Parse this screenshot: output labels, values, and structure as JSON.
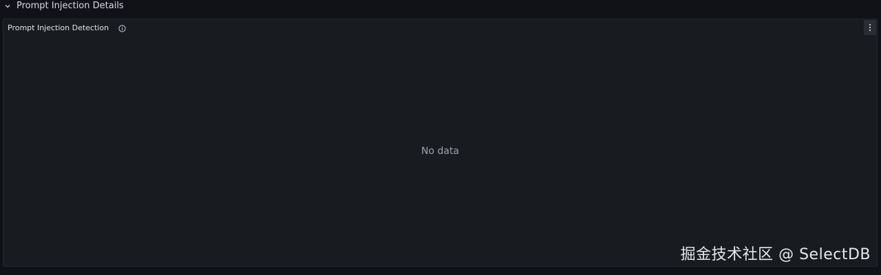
{
  "row": {
    "title": "Prompt Injection Details",
    "chevron_icon": "chevron-down-icon"
  },
  "panel": {
    "title": "Prompt Injection Detection",
    "info_icon": "info-circle-icon",
    "menu_icon": "kebab-menu-icon",
    "empty_text": "No data"
  },
  "watermark": "掘金技术社区 @ SelectDB",
  "colors": {
    "background": "#111217",
    "panel_bg": "#181b1f",
    "panel_border": "#24272e",
    "text": "#ccccdc",
    "muted_text": "#9fa1ab"
  }
}
